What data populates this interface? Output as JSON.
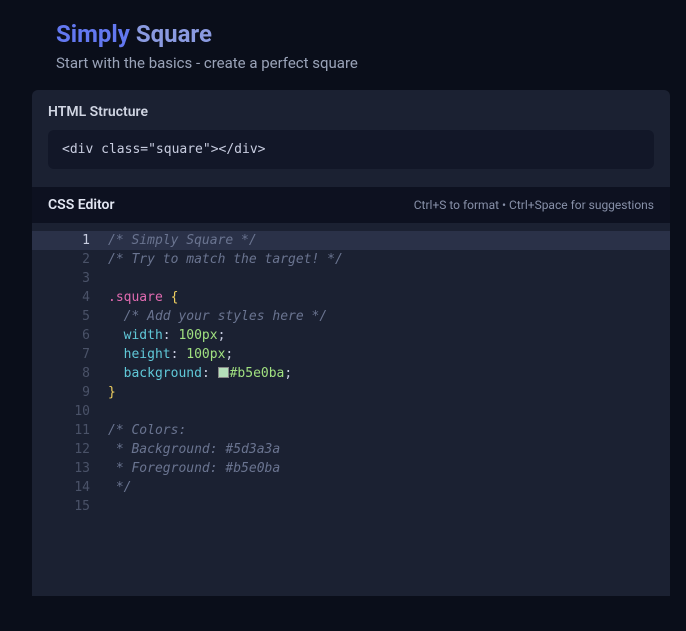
{
  "header": {
    "title_word1": "Simply",
    "title_word2": "Square",
    "subtitle": "Start with the basics - create a perfect square"
  },
  "html_structure": {
    "label": "HTML Structure",
    "code": "<div class=\"square\"></div>"
  },
  "css_editor": {
    "title": "CSS Editor",
    "hint": "Ctrl+S to format • Ctrl+Space for suggestions"
  },
  "code_lines": [
    {
      "n": 1,
      "hl": true,
      "indent": 0,
      "tokens": [
        {
          "cls": "cm",
          "t": "/* Simply Square */"
        }
      ]
    },
    {
      "n": 2,
      "hl": false,
      "indent": 0,
      "tokens": [
        {
          "cls": "cm",
          "t": "/* Try to match the target! */"
        }
      ]
    },
    {
      "n": 3,
      "hl": false,
      "indent": 0,
      "tokens": []
    },
    {
      "n": 4,
      "hl": false,
      "indent": 0,
      "tokens": [
        {
          "cls": "sel",
          "t": ".square"
        },
        {
          "cls": "",
          "t": " "
        },
        {
          "cls": "brace",
          "t": "{"
        }
      ]
    },
    {
      "n": 5,
      "hl": false,
      "indent": 1,
      "tokens": [
        {
          "cls": "cm",
          "t": "/* Add your styles here */"
        }
      ]
    },
    {
      "n": 6,
      "hl": false,
      "indent": 1,
      "tokens": [
        {
          "cls": "prop",
          "t": "width"
        },
        {
          "cls": "punct",
          "t": ": "
        },
        {
          "cls": "val",
          "t": "100px"
        },
        {
          "cls": "punct",
          "t": ";"
        }
      ]
    },
    {
      "n": 7,
      "hl": false,
      "indent": 1,
      "tokens": [
        {
          "cls": "prop",
          "t": "height"
        },
        {
          "cls": "punct",
          "t": ": "
        },
        {
          "cls": "val",
          "t": "100px"
        },
        {
          "cls": "punct",
          "t": ";"
        }
      ]
    },
    {
      "n": 8,
      "hl": false,
      "indent": 1,
      "tokens": [
        {
          "cls": "prop",
          "t": "background"
        },
        {
          "cls": "punct",
          "t": ": "
        },
        {
          "cls": "swatch",
          "t": "",
          "color": "#b5e0ba"
        },
        {
          "cls": "val",
          "t": "#b5e0ba"
        },
        {
          "cls": "punct",
          "t": ";"
        }
      ]
    },
    {
      "n": 9,
      "hl": false,
      "indent": 0,
      "tokens": [
        {
          "cls": "brace",
          "t": "}"
        }
      ]
    },
    {
      "n": 10,
      "hl": false,
      "indent": 0,
      "tokens": []
    },
    {
      "n": 11,
      "hl": false,
      "indent": 0,
      "tokens": [
        {
          "cls": "cm",
          "t": "/* Colors:"
        }
      ]
    },
    {
      "n": 12,
      "hl": false,
      "indent": 0,
      "tokens": [
        {
          "cls": "cm",
          "t": " * Background: #5d3a3a"
        }
      ]
    },
    {
      "n": 13,
      "hl": false,
      "indent": 0,
      "tokens": [
        {
          "cls": "cm",
          "t": " * Foreground: #b5e0ba"
        }
      ]
    },
    {
      "n": 14,
      "hl": false,
      "indent": 0,
      "tokens": [
        {
          "cls": "cm",
          "t": " */"
        }
      ]
    },
    {
      "n": 15,
      "hl": false,
      "indent": 0,
      "tokens": []
    }
  ]
}
